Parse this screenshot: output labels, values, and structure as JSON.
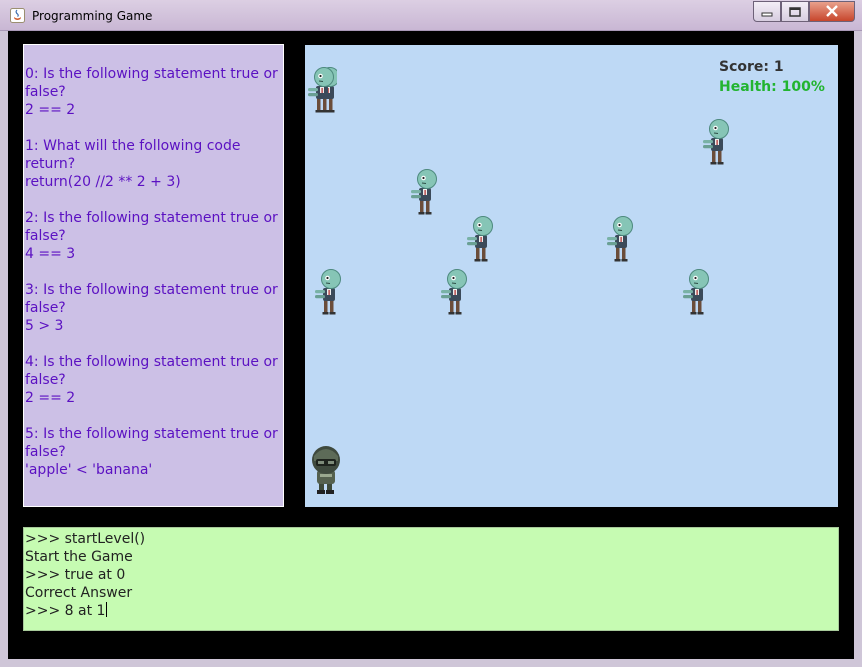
{
  "window": {
    "title": "Programming Game",
    "icons": [
      "java-app-icon",
      "minimize-icon",
      "maximize-icon",
      "close-icon"
    ]
  },
  "questions": [
    {
      "prompt": "0: Is the following statement true or false?",
      "code": "2 == 2"
    },
    {
      "prompt": "1: What will the following code return?",
      "code": "return(20 //2 ** 2 + 3)"
    },
    {
      "prompt": "2: Is the following statement true or false?",
      "code": "4 == 3"
    },
    {
      "prompt": "3: Is the following statement true or false?",
      "code": "5 > 3"
    },
    {
      "prompt": "4: Is the following statement true or false?",
      "code": "2 == 2"
    },
    {
      "prompt": "5: Is the following statement true or false?",
      "code": "'apple' < 'banana'"
    }
  ],
  "hud": {
    "score": "Score: 1",
    "health": "Health: 100%",
    "health_color": "#22b430"
  },
  "entities": {
    "zombie_count": 9,
    "player": "soldier-icon"
  },
  "console": {
    "lines": [
      ">>> startLevel()",
      "Start the Game",
      ">>> true at 0",
      "Correct Answer"
    ],
    "input": ">>> 8 at 1"
  },
  "colors": {
    "question_text": "#5b11c2",
    "question_bg": "#ccc0e6",
    "game_bg": "#bed9f5",
    "console_bg": "#c6fbb2"
  }
}
